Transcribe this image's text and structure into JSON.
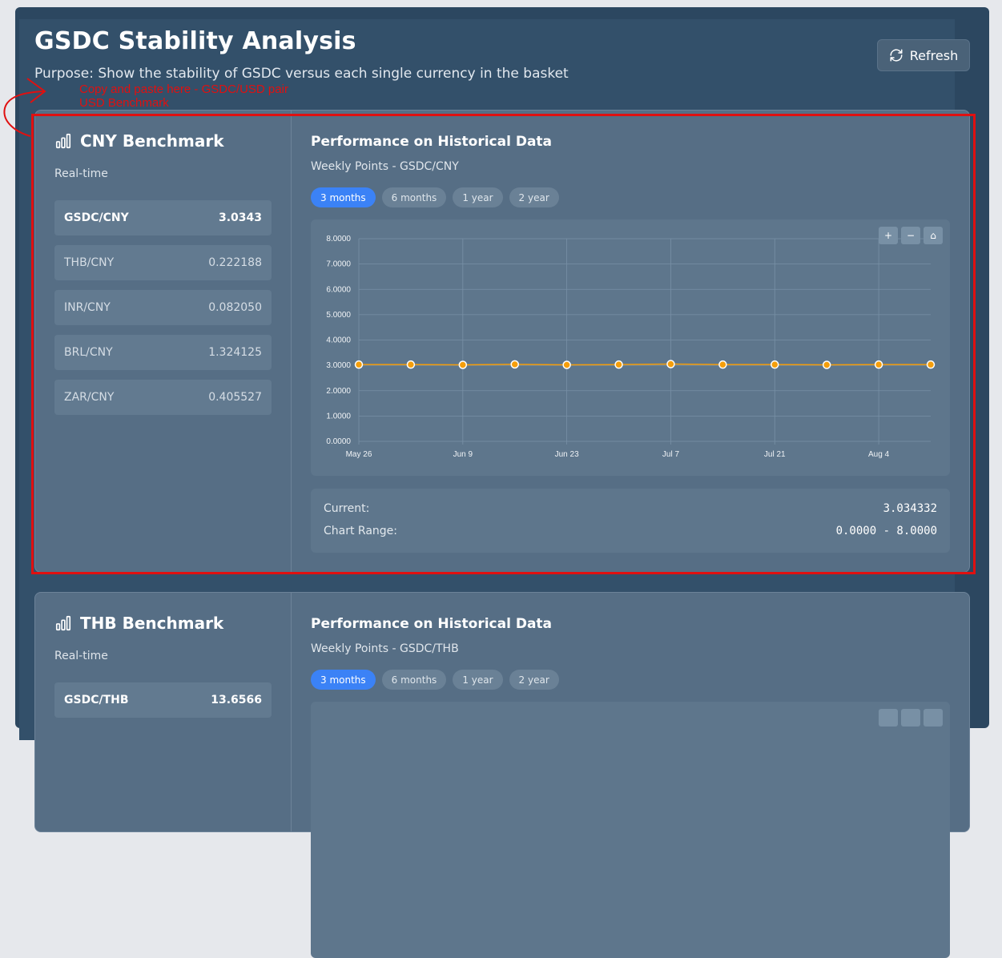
{
  "header": {
    "title": "GSDC Stability Analysis",
    "purpose": "Purpose: Show the stability of GSDC versus each single currency in the basket",
    "refresh_label": "Refresh"
  },
  "annotation": {
    "line1": "Copy and paste here  - GSDC/USD pair",
    "line2": "USD Benchmark",
    "color": "#e01010"
  },
  "colors": {
    "accent": "#3b82f6",
    "series": "#f59e0b",
    "annotation": "#e01010"
  },
  "cards": [
    {
      "title": "CNY Benchmark",
      "realtime": "Real-time",
      "rates": [
        {
          "pair": "GSDC/CNY",
          "value": "3.0343"
        },
        {
          "pair": "THB/CNY",
          "value": "0.222188"
        },
        {
          "pair": "INR/CNY",
          "value": "0.082050"
        },
        {
          "pair": "BRL/CNY",
          "value": "1.324125"
        },
        {
          "pair": "ZAR/CNY",
          "value": "0.405527"
        }
      ],
      "perf_title": "Performance on Historical Data",
      "perf_sub": "Weekly Points - GSDC/CNY",
      "ranges": [
        "3 months",
        "6 months",
        "1 year",
        "2 year"
      ],
      "active_range": "3 months",
      "zoom": [
        "+",
        "−",
        "⌂"
      ],
      "stats": {
        "current_label": "Current:",
        "current_value": "3.034332",
        "range_label": "Chart Range:",
        "range_value": "0.0000 - 8.0000"
      }
    },
    {
      "title": "THB Benchmark",
      "realtime": "Real-time",
      "rates": [
        {
          "pair": "GSDC/THB",
          "value": "13.6566"
        }
      ],
      "perf_title": "Performance on Historical Data",
      "perf_sub": "Weekly Points - GSDC/THB",
      "ranges": [
        "3 months",
        "6 months",
        "1 year",
        "2 year"
      ],
      "active_range": "3 months"
    }
  ],
  "chart_data": {
    "type": "line",
    "title": "",
    "xlabel": "",
    "ylabel": "",
    "x": [
      "May 26",
      "Jun 2",
      "Jun 9",
      "Jun 16",
      "Jun 23",
      "Jun 30",
      "Jul 7",
      "Jul 14",
      "Jul 21",
      "Jul 28",
      "Aug 4",
      "Aug 11"
    ],
    "x_tick_labels": [
      "May 26",
      "Jun 9",
      "Jun 23",
      "Jul 7",
      "Jul 21",
      "Aug 4"
    ],
    "values": [
      3.03,
      3.03,
      3.02,
      3.04,
      3.02,
      3.03,
      3.05,
      3.03,
      3.03,
      3.02,
      3.03,
      3.03
    ],
    "y_tick_labels": [
      "0.0000",
      "1.0000",
      "2.0000",
      "3.0000",
      "4.0000",
      "5.0000",
      "6.0000",
      "7.0000",
      "8.0000"
    ],
    "ylim": [
      0,
      8
    ],
    "grid": true
  }
}
